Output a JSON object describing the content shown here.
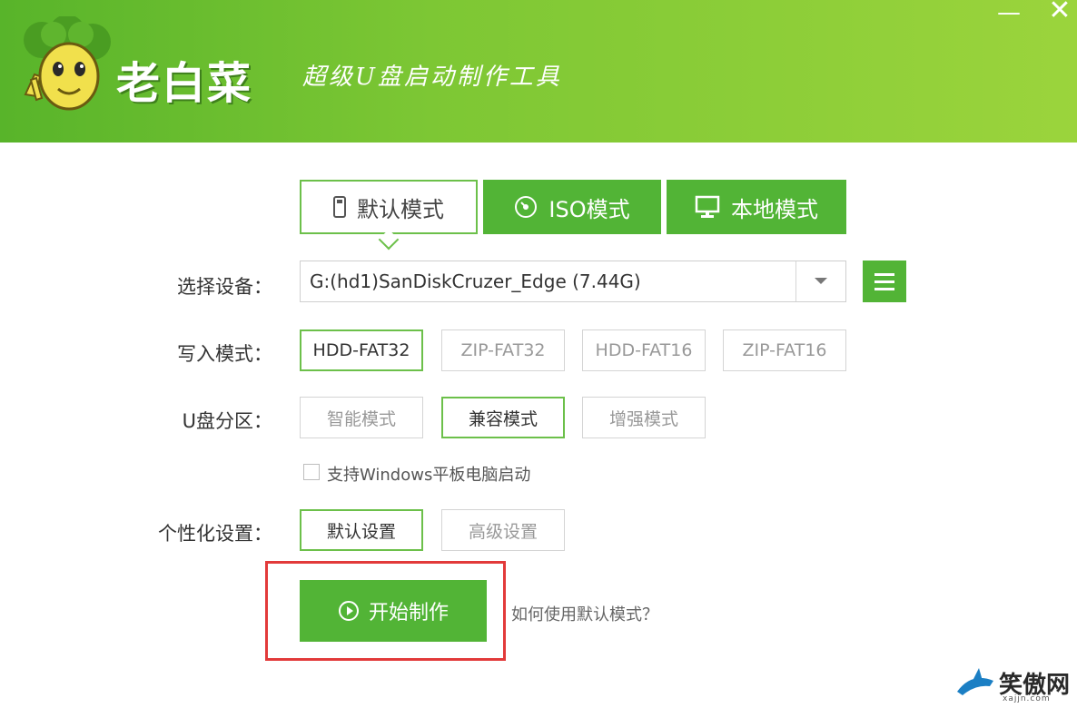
{
  "header": {
    "app_title": "老白菜",
    "slogan": "超级U盘启动制作工具",
    "minimize_symbol": "—",
    "close_symbol": "✕"
  },
  "tabs": [
    {
      "label": "默认模式",
      "icon": "usb-drive-icon",
      "selected": true
    },
    {
      "label": "ISO模式",
      "icon": "disc-icon",
      "selected": false
    },
    {
      "label": "本地模式",
      "icon": "monitor-icon",
      "selected": false
    }
  ],
  "device": {
    "label": "选择设备：",
    "value": "G:(hd1)SanDiskCruzer_Edge (7.44G)"
  },
  "write_mode": {
    "label": "写入模式：",
    "options": [
      "HDD-FAT32",
      "ZIP-FAT32",
      "HDD-FAT16",
      "ZIP-FAT16"
    ],
    "selected": "HDD-FAT32"
  },
  "partition": {
    "label": "U盘分区：",
    "options": [
      "智能模式",
      "兼容模式",
      "增强模式"
    ],
    "selected": "兼容模式"
  },
  "tablet_support": {
    "label": "支持Windows平板电脑启动",
    "checked": false
  },
  "personalize": {
    "label": "个性化设置：",
    "options": [
      "默认设置",
      "高级设置"
    ],
    "selected": "默认设置"
  },
  "start_button": {
    "label": "开始制作"
  },
  "help_link": "如何使用默认模式？",
  "watermark": {
    "text": "笑傲网",
    "sub": "xajjn.com"
  },
  "colors": {
    "header_green": "#7dc734",
    "button_green": "#52b436",
    "selected_border": "#6cc04a",
    "highlight_red": "#e23a3a"
  }
}
